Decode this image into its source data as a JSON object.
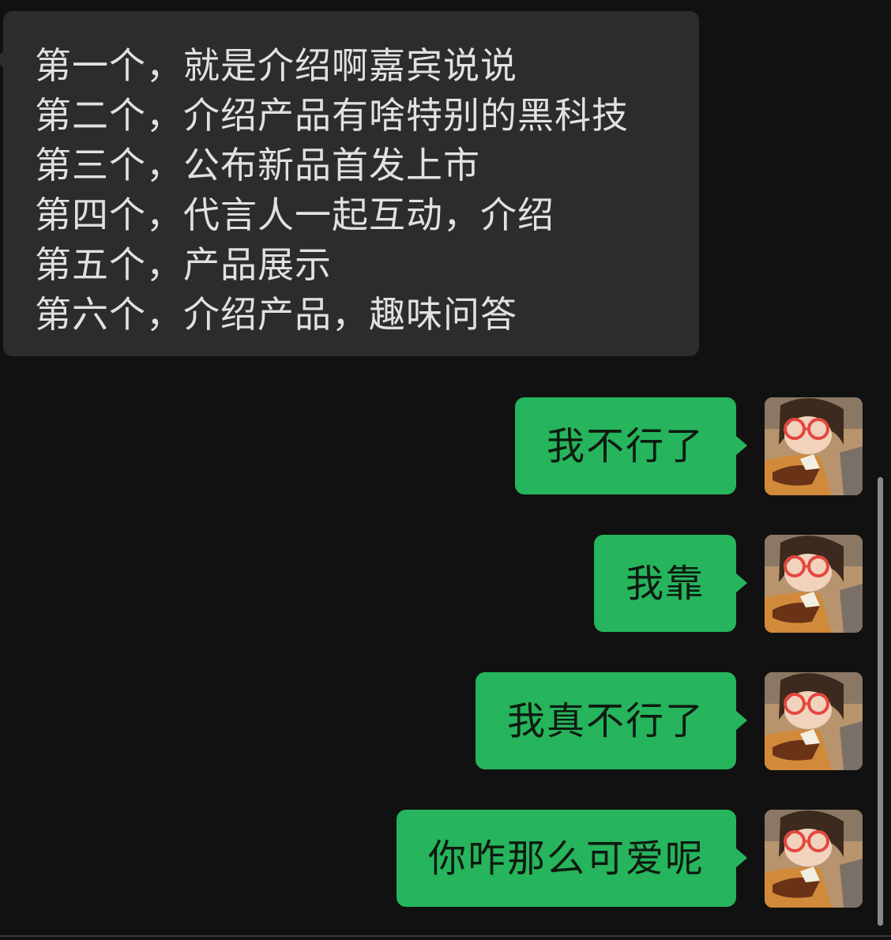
{
  "incoming": {
    "lines": [
      "第一个，就是介绍啊嘉宾说说",
      "第二个，介绍产品有啥特别的黑科技",
      "第三个，公布新品首发上市",
      "第四个，代言人一起互动，介绍",
      "第五个，产品展示",
      "第六个，介绍产品，趣味问答"
    ]
  },
  "outgoing": [
    {
      "text": "我不行了"
    },
    {
      "text": "我靠"
    },
    {
      "text": "我真不行了"
    },
    {
      "text": "你咋那么可爱呢"
    }
  ],
  "colors": {
    "background": "#111111",
    "incoming_bubble": "#2c2c2c",
    "outgoing_bubble": "#26b45c"
  },
  "icons": {
    "avatar": "user-avatar-photo"
  }
}
